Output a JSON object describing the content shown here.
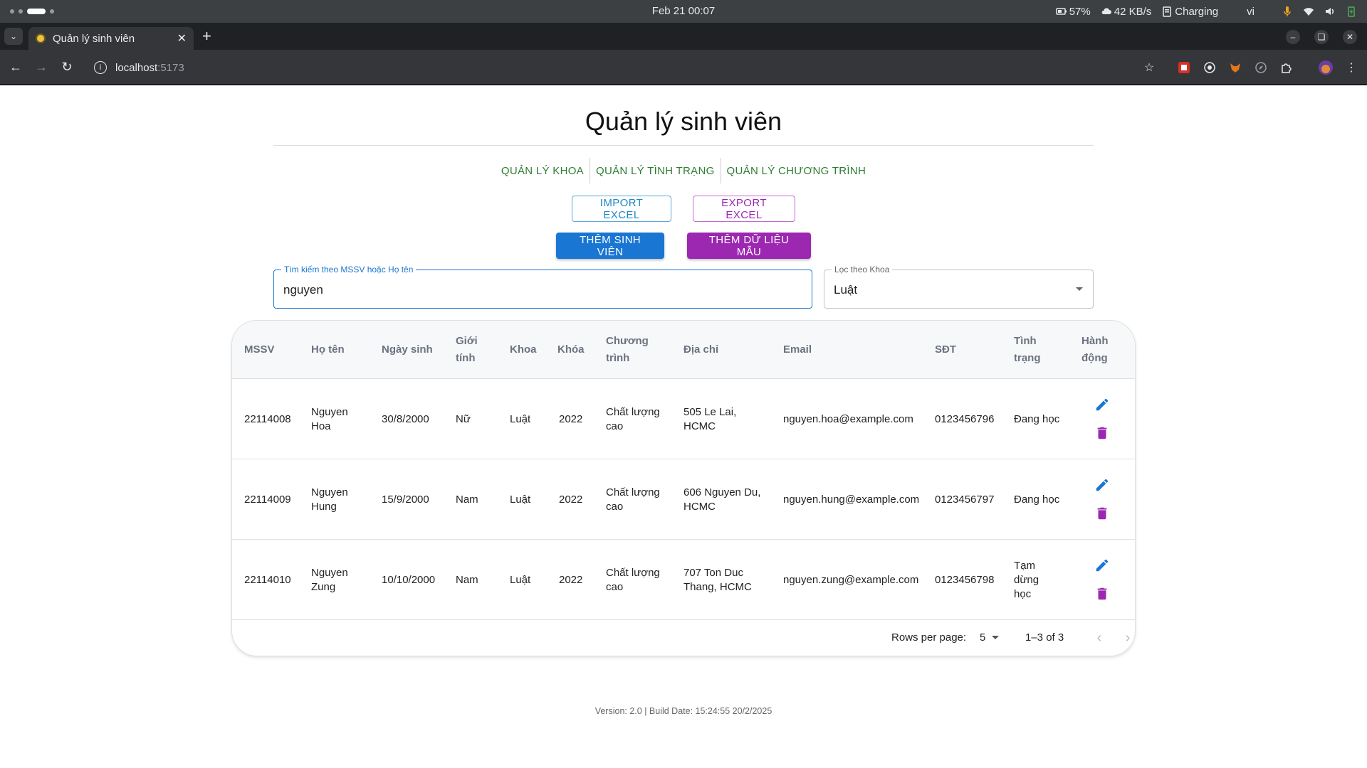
{
  "os": {
    "clock": "Feb 21  00:07",
    "battery": "57%",
    "network_speed": "42 KB/s",
    "power_status": "Charging",
    "input_lang": "vi"
  },
  "browser": {
    "tab_title": "Quản lý sinh viên",
    "url_host": "localhost",
    "url_port": ":5173"
  },
  "page": {
    "title": "Quản lý sinh viên",
    "nav": [
      "QUẢN LÝ KHOA",
      "QUẢN LÝ TÌNH TRẠNG",
      "QUẢN LÝ CHƯƠNG TRÌNH"
    ],
    "buttons": {
      "import": "IMPORT EXCEL",
      "export": "EXPORT EXCEL",
      "add_student": "THÊM SINH VIÊN",
      "add_sample": "THÊM DỮ LIỆU MẪU"
    },
    "search": {
      "label": "Tìm kiếm theo MSSV hoặc Họ tên",
      "value": "nguyen"
    },
    "filter": {
      "label": "Lọc theo Khoa",
      "value": "Luật"
    },
    "table": {
      "headers": [
        "MSSV",
        "Họ tên",
        "Ngày sinh",
        "Giới tính",
        "Khoa",
        "Khóa",
        "Chương trình",
        "Địa chỉ",
        "Email",
        "SĐT",
        "Tình trạng",
        "Hành động"
      ],
      "rows": [
        [
          "22114008",
          "Nguyen Hoa",
          "30/8/2000",
          "Nữ",
          "Luật",
          "2022",
          "Chất lượng cao",
          "505 Le Lai, HCMC",
          "nguyen.hoa@example.com",
          "0123456796",
          "Đang học"
        ],
        [
          "22114009",
          "Nguyen Hung",
          "15/9/2000",
          "Nam",
          "Luật",
          "2022",
          "Chất lượng cao",
          "606 Nguyen Du, HCMC",
          "nguyen.hung@example.com",
          "0123456797",
          "Đang học"
        ],
        [
          "22114010",
          "Nguyen Zung",
          "10/10/2000",
          "Nam",
          "Luật",
          "2022",
          "Chất lượng cao",
          "707 Ton Duc Thang, HCMC",
          "nguyen.zung@example.com",
          "0123456798",
          "Tạm dừng học"
        ]
      ]
    },
    "pagination": {
      "rows_per_page_label": "Rows per page:",
      "rows_per_page": "5",
      "range": "1–3 of 3"
    },
    "footer": "Version: 2.0 | Build Date: 15:24:55 20/2/2025"
  },
  "colors": {
    "nav_link": "#2e7d32",
    "primary_blue": "#1976d2",
    "purple": "#9c27b0",
    "edit_icon": "#1976d2",
    "delete_icon": "#9c27b0"
  }
}
